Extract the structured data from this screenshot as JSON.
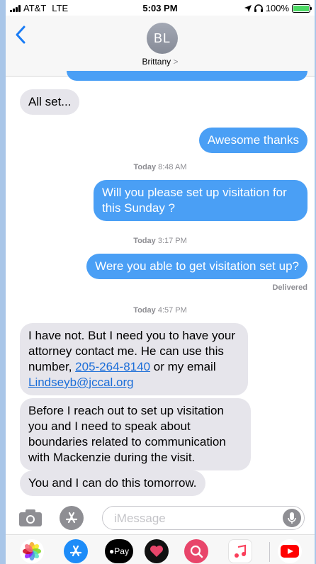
{
  "status_bar": {
    "carrier": "AT&T",
    "network": "LTE",
    "time": "5:03 PM",
    "battery": "100%"
  },
  "header": {
    "avatar_initials": "BL",
    "contact_name": "Brittany",
    "chevron": ">"
  },
  "messages": {
    "m1": "All set...",
    "m2": "Awesome thanks",
    "ts1": {
      "day": "Today",
      "time": "8:48 AM"
    },
    "m3": "Will you please set up visitation for this Sunday ?",
    "ts2": {
      "day": "Today",
      "time": "3:17 PM"
    },
    "m4": "Were you able to get visitation set up?",
    "delivered": "Delivered",
    "ts3": {
      "day": "Today",
      "time": "4:57 PM"
    },
    "m5": {
      "text_a": "I have not. But I need you to have your attorney contact me. He can use this number, ",
      "phone": "205-264-8140",
      "text_b": " or my email ",
      "email": "Lindseyb@jccal.org"
    },
    "m6": "Before I reach out to set up visitation you and I need to speak about boundaries related to communication with Mackenzie during the visit.",
    "m7": "You and I can do this tomorrow."
  },
  "input": {
    "placeholder": "iMessage"
  },
  "icons": {
    "back": "back-chevron-icon",
    "camera": "camera-icon",
    "apps": "app-store-icon",
    "mic": "microphone-icon",
    "drawer": [
      "photos-icon",
      "app-store-icon",
      "apple-pay-icon",
      "digital-touch-icon",
      "web-images-icon",
      "music-icon",
      "youtube-icon"
    ]
  },
  "drawer_labels": {
    "pay": "Pay"
  },
  "colors": {
    "outgoing": "#4a9ff5",
    "incoming": "#e6e5eb",
    "link": "#1a6dd8",
    "battery": "#4cd964"
  }
}
